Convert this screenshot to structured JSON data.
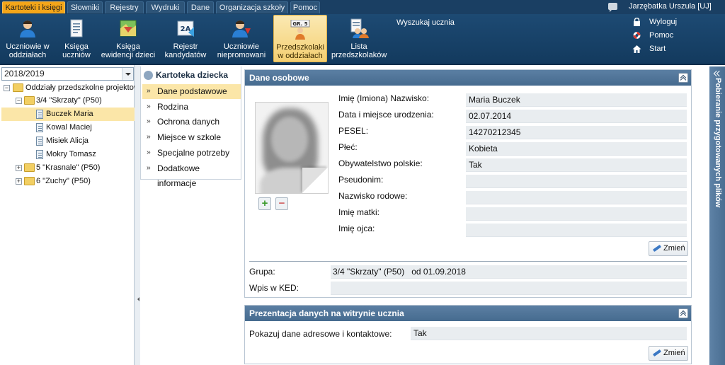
{
  "menu": {
    "tabs": [
      {
        "label": "Kartoteki i księgi",
        "active": true
      },
      {
        "label": "Słowniki"
      },
      {
        "label": "Rejestry"
      },
      {
        "label": "Wydruki"
      },
      {
        "label": "Dane"
      },
      {
        "label": "Organizacja szkoły"
      },
      {
        "label": "Pomoc"
      }
    ],
    "user": "Jarzębatka Urszula [UJ]"
  },
  "ribbon": {
    "buttons": [
      {
        "line1": "Uczniowie w",
        "line2": "oddziałach",
        "icon": "student-icon"
      },
      {
        "line1": "Księga",
        "line2": "uczniów",
        "icon": "book-icon"
      },
      {
        "line1": "Księga",
        "line2": "ewidencji dzieci",
        "icon": "map-book-icon"
      },
      {
        "line1": "Rejestr",
        "line2": "kandydatów",
        "icon": "register-2a-icon"
      },
      {
        "line1": "Uczniowie",
        "line2": "niepromowani",
        "icon": "student-down-icon"
      },
      {
        "line1": "Przedszkolaki",
        "line2": "w oddziałach",
        "icon": "preschool-group-icon",
        "badge": "GR. 5",
        "active": true
      },
      {
        "line1": "Lista",
        "line2": "przedszkolaków",
        "icon": "preschool-list-icon"
      }
    ],
    "search_label": "Wyszukaj ucznia",
    "side_links": [
      {
        "label": "Wyloguj",
        "icon": "lock-icon"
      },
      {
        "label": "Pomoc",
        "icon": "lifebuoy-icon"
      },
      {
        "label": "Start",
        "icon": "home-icon"
      }
    ]
  },
  "tree": {
    "year": "2018/2019",
    "root": "Oddziały przedszkolne projektowa",
    "groups": [
      {
        "label": "3/4 \"Skrzaty\" (P50)",
        "expanded": true,
        "children": [
          "Buczek Maria",
          "Kowal Maciej",
          "Misiek Alicja",
          "Mokry Tomasz"
        ]
      },
      {
        "label": "5 \"Krasnale\" (P50)"
      },
      {
        "label": "6 \"Zuchy\" (P50)"
      }
    ],
    "expand_sign": "+",
    "collapse_sign": "−"
  },
  "nav": {
    "title": "Kartoteka dziecka",
    "items": [
      "Dane podstawowe",
      "Rodzina",
      "Ochrona danych",
      "Miejsce w szkole",
      "Specjalne potrzeby",
      "Dodatkowe informacje"
    ]
  },
  "personal": {
    "title": "Dane osobowe",
    "fields": [
      {
        "label": "Imię (Imiona) Nazwisko:",
        "value": "Maria Buczek"
      },
      {
        "label": "Data i miejsce urodzenia:",
        "value": "02.07.2014"
      },
      {
        "label": "PESEL:",
        "value": "14270212345"
      },
      {
        "label": "Płeć:",
        "value": "Kobieta"
      },
      {
        "label": "Obywatelstwo polskie:",
        "value": "Tak"
      },
      {
        "label": "Pseudonim:",
        "value": ""
      },
      {
        "label": "Nazwisko rodowe:",
        "value": ""
      },
      {
        "label": "Imię matki:",
        "value": ""
      },
      {
        "label": "Imię ojca:",
        "value": ""
      }
    ],
    "edit_label": "Zmień",
    "group_label": "Grupa:",
    "group_value": "3/4 \"Skrzaty\" (P50)   od 01.09.2018",
    "ked_label": "Wpis w KED:",
    "ked_value": "",
    "add_sign": "+",
    "remove_sign": "−"
  },
  "website": {
    "title": "Prezentacja danych na witrynie ucznia",
    "fields": [
      {
        "label": "Pokazuj dane adresowe i kontaktowe:",
        "value": "Tak"
      }
    ],
    "edit_label": "Zmień"
  },
  "right_panel": {
    "label": "Pobieranie przygotowanych plików"
  }
}
